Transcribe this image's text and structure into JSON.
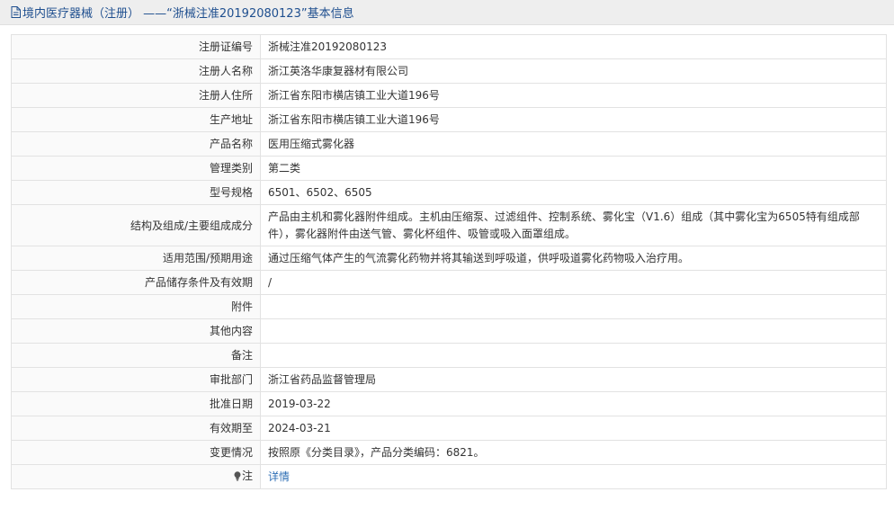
{
  "header": {
    "title": "境内医疗器械（注册） ——“浙械注准20192080123”基本信息"
  },
  "rows": [
    {
      "label": "注册证编号",
      "value": "浙械注准20192080123"
    },
    {
      "label": "注册人名称",
      "value": "浙江英洛华康复器材有限公司"
    },
    {
      "label": "注册人住所",
      "value": "浙江省东阳市横店镇工业大道196号"
    },
    {
      "label": "生产地址",
      "value": "浙江省东阳市横店镇工业大道196号"
    },
    {
      "label": "产品名称",
      "value": "医用压缩式雾化器"
    },
    {
      "label": "管理类别",
      "value": "第二类"
    },
    {
      "label": "型号规格",
      "value": "6501、6502、6505"
    },
    {
      "label": "结构及组成/主要组成成分",
      "value": "产品由主机和雾化器附件组成。主机由压缩泵、过滤组件、控制系统、雾化宝（V1.6）组成（其中雾化宝为6505特有组成部件），雾化器附件由送气管、雾化杯组件、吸管或吸入面罩组成。"
    },
    {
      "label": "适用范围/预期用途",
      "value": "通过压缩气体产生的气流雾化药物并将其输送到呼吸道，供呼吸道雾化药物吸入治疗用。"
    },
    {
      "label": "产品储存条件及有效期",
      "value": "/"
    },
    {
      "label": "附件",
      "value": ""
    },
    {
      "label": "其他内容",
      "value": ""
    },
    {
      "label": "备注",
      "value": ""
    },
    {
      "label": "审批部门",
      "value": "浙江省药品监督管理局"
    },
    {
      "label": "批准日期",
      "value": "2019-03-22"
    },
    {
      "label": "有效期至",
      "value": "2024-03-21"
    },
    {
      "label": "变更情况",
      "value": "按照原《分类目录》，产品分类编码：6821。"
    }
  ],
  "note": {
    "label": "注",
    "link_text": "详情",
    "icon": "lightbulb-icon"
  },
  "colors": {
    "title": "#1f4f8f",
    "link": "#2f6fb5",
    "header_bg": "#eeeeee",
    "border": "#e2e2e2"
  }
}
